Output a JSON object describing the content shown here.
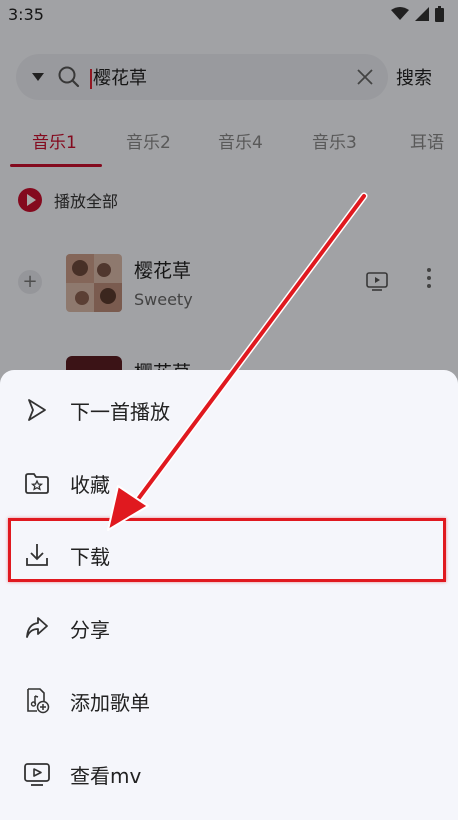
{
  "status": {
    "time": "3:35"
  },
  "search": {
    "query": "樱花草",
    "button_label": "搜索"
  },
  "tabs": [
    {
      "label": "音乐1",
      "active": true
    },
    {
      "label": "音乐2",
      "active": false
    },
    {
      "label": "音乐4",
      "active": false
    },
    {
      "label": "音乐3",
      "active": false
    },
    {
      "label": "耳语",
      "active": false
    }
  ],
  "play_all": {
    "label": "播放全部"
  },
  "songs": [
    {
      "title": "樱花草",
      "artist": "Sweety"
    },
    {
      "title": "樱花草",
      "artist": ""
    }
  ],
  "sheet": {
    "items": [
      {
        "label": "下一首播放",
        "icon": "play-next-icon"
      },
      {
        "label": "收藏",
        "icon": "favorite-folder-icon"
      },
      {
        "label": "下载",
        "icon": "download-icon",
        "highlighted": true
      },
      {
        "label": "分享",
        "icon": "share-icon"
      },
      {
        "label": "添加歌单",
        "icon": "add-to-playlist-icon"
      },
      {
        "label": "查看mv",
        "icon": "mv-icon"
      }
    ]
  },
  "colors": {
    "accent": "#c8102e",
    "highlight": "#e0191f",
    "sheet_bg": "#f5f6fb"
  }
}
